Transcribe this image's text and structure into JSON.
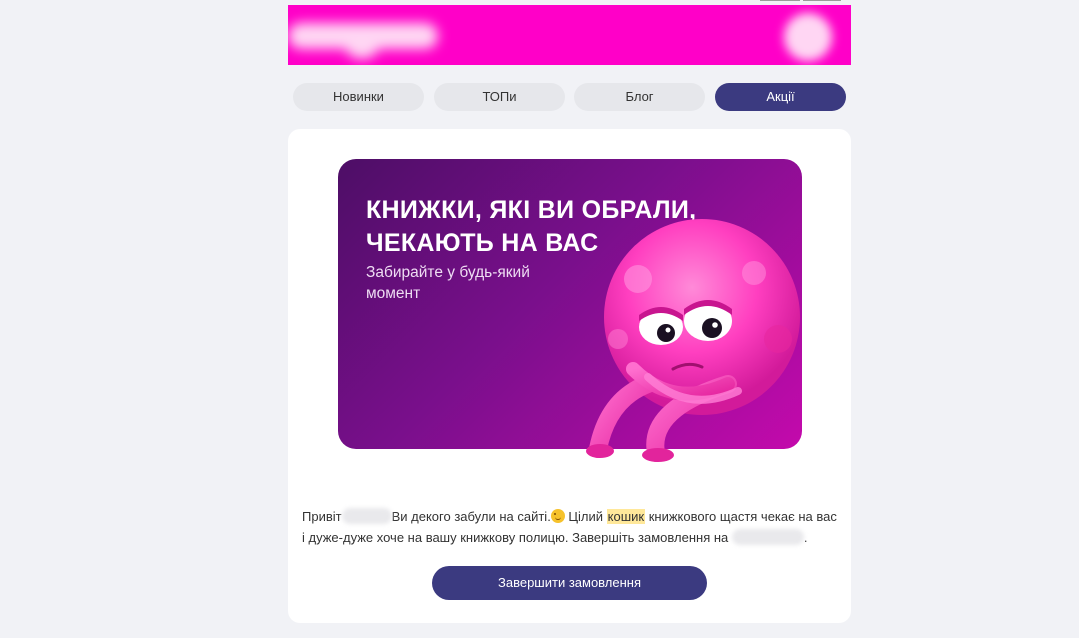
{
  "nav": {
    "tabs": [
      {
        "label": "Новинки",
        "active": false
      },
      {
        "label": "ТОПи",
        "active": false
      },
      {
        "label": "Блог",
        "active": false
      },
      {
        "label": "Акції",
        "active": true
      }
    ]
  },
  "promo": {
    "title_line1": "КНИЖКИ, ЯКІ ВИ ОБРАЛИ,",
    "title_line2": "ЧЕКАЮТЬ НА ВАС",
    "subtitle_line1": "Забирайте у будь-який",
    "subtitle_line2": "момент",
    "mascot_icon": "pink-fluffy-monster"
  },
  "message": {
    "part1": "Привіт",
    "part2": "Ви декого забули на сайті.",
    "part3": " Цілий ",
    "highlight": "кошик",
    "part4": " книжкового щастя чекає на вас і дуже-дуже хоче на вашу книжкову полицю. Завершіть замовлення на ",
    "part5": ".",
    "emoji_icon": "wink-emoji-icon"
  },
  "cta": {
    "label": "Завершити замовлення"
  },
  "colors": {
    "header_bg": "#ff00c8",
    "accent": "#3b3a80",
    "page_bg": "#f1f2f6",
    "highlight": "#ffe89a"
  }
}
